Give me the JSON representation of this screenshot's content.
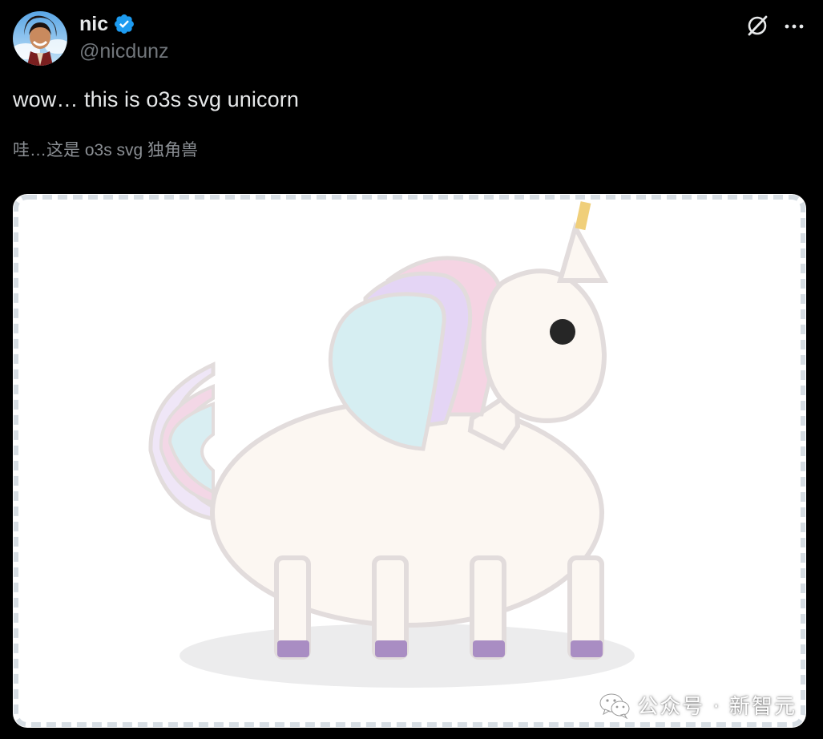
{
  "author": {
    "display_name": "nic",
    "handle": "@nicdunz",
    "verified": true
  },
  "tweet": {
    "text": "wow… this is o3s svg unicorn",
    "translation": "哇…这是 o3s svg 独角兽"
  },
  "icons": {
    "verified": "verified-badge-icon",
    "grok": "grok-icon",
    "more": "more-options-icon",
    "wechat": "wechat-icon"
  },
  "colors": {
    "background": "#000000",
    "text_primary": "#e7e9ea",
    "text_secondary": "#71767b",
    "verified_blue": "#1d9bf0",
    "unicorn_body": "#fcf7f2",
    "unicorn_outline": "#e2dcdc",
    "mane_pink": "#f5d4e3",
    "mane_lavender": "#e4d5f5",
    "mane_cyan": "#d6eef2",
    "hooves": "#a98dc3",
    "horn_tip": "#f0cf7a"
  },
  "watermark": {
    "text": "公众号 · 新智元"
  }
}
